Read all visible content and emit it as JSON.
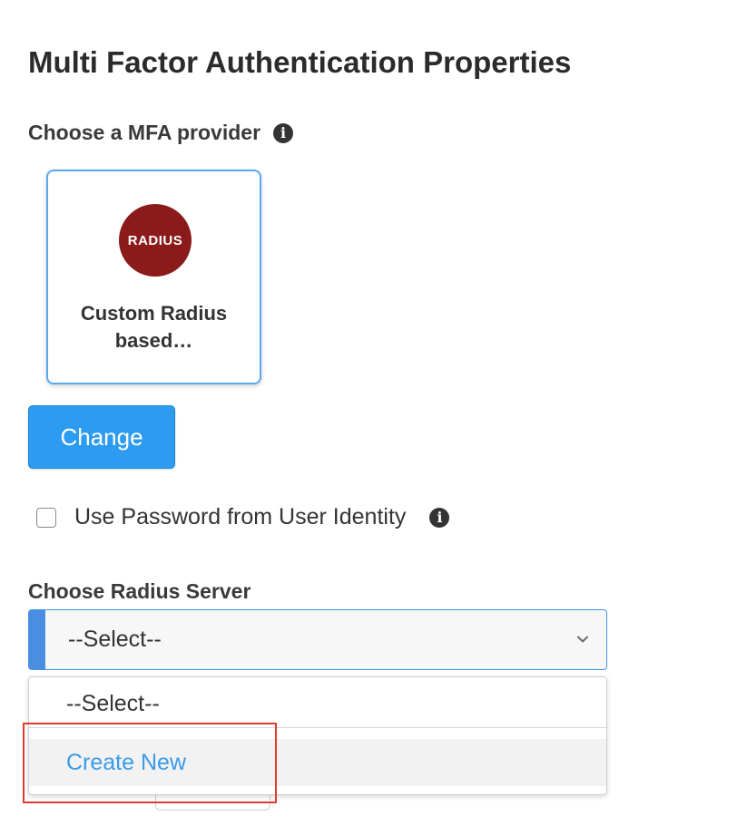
{
  "page": {
    "title": "Multi Factor Authentication Properties"
  },
  "mfa_provider": {
    "label": "Choose a MFA provider",
    "info_icon": "info-circle-icon",
    "selected": {
      "logo_text": "RADIUS",
      "logo_color": "#8b1a1a",
      "name": "Custom Radius based…"
    },
    "change_label": "Change"
  },
  "use_password": {
    "label": "Use Password from User Identity",
    "checked": false,
    "info_icon": "info-circle-icon"
  },
  "radius_server": {
    "label": "Choose Radius Server",
    "selected_value": "--Select--",
    "options": [
      {
        "label": "--Select--"
      },
      {
        "label": "Create New",
        "highlighted": true
      }
    ]
  },
  "colors": {
    "primary_button": "#2d9cf0",
    "focus_border": "#3f95e6",
    "link": "#3a9be8",
    "annotation_box": "#e23b30"
  }
}
